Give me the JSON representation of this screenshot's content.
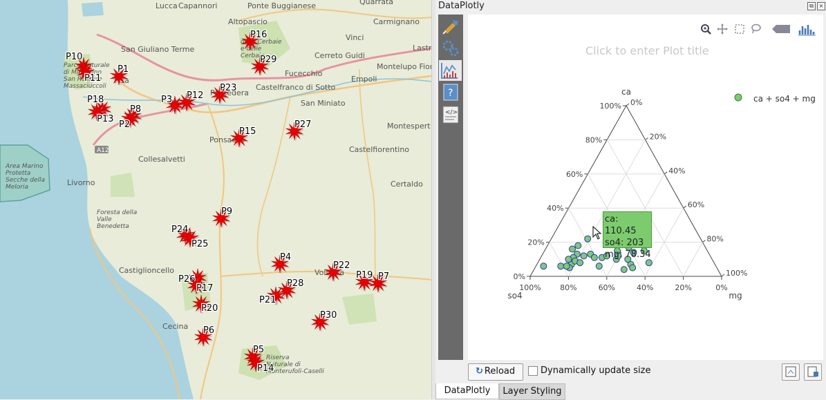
{
  "map": {
    "towns": [
      "Lucca",
      "Capannori",
      "Ponte Buggianese",
      "Quarrata",
      "Carmignano",
      "Altopascio",
      "San Giuliano Terme",
      "Cerreto Guidi",
      "Vinci",
      "Montelupo Fiorentino",
      "Lastra",
      "Pisa",
      "Fucecchio",
      "Empoli",
      "Castelfranco di Sotto",
      "Pontedera",
      "San Miniato",
      "Montespert",
      "Ponsacco",
      "Castelfiorentino",
      "Collesalvetti",
      "Livorno",
      "Certaldo",
      "Castiglioncello",
      "Volterra",
      "Cecina"
    ],
    "area_labels": [
      "Area Marino Protetta Secche della Meloria",
      "Foresta della Valle Benedetta",
      "Parco Naturale di Migliarino San Rossore Massaciuccoli",
      "Riserva Naturale di Monterufoli-Caselli",
      "delle Cerbaie e delle Cerbaie"
    ],
    "road": "A12",
    "points": [
      "P10",
      "P1",
      "P11",
      "P18",
      "P13",
      "P8",
      "P2",
      "P3",
      "P12",
      "P23",
      "P16",
      "P29",
      "P15",
      "P27",
      "P9",
      "P24",
      "P25",
      "P4",
      "P22",
      "P19",
      "P7",
      "P26",
      "P17",
      "P28",
      "P21",
      "P20",
      "P30",
      "P6",
      "P5",
      "P14"
    ]
  },
  "dock": {
    "title": "DataPlotly",
    "float_icon": "float-icon",
    "close_icon": "close-icon"
  },
  "sidebar": {
    "icons": [
      "brush-icon",
      "settings-gears-icon",
      "plot-line-icon",
      "help-icon",
      "code-icon"
    ]
  },
  "plot": {
    "title_placeholder": "Click to enter Plot title",
    "modebar": [
      "zoom-icon",
      "pan-icon",
      "box-select-icon",
      "lasso-icon",
      "plotly-logo-icon",
      "histogram-icon"
    ],
    "legend_label": "ca + so4 + mg",
    "marker_color": "#7ccc6e",
    "marker_edge": "#3030c0",
    "hover": {
      "ca": "ca: 110.45",
      "so4": "so4: 203",
      "mg": "mg: 78.34"
    },
    "hover_bg": "#7ccc6e"
  },
  "chart_data": {
    "type": "scatter",
    "subtype": "ternary",
    "axes": {
      "a": "ca",
      "b": "so4",
      "c": "mg"
    },
    "tick_labels": [
      "0%",
      "20%",
      "40%",
      "60%",
      "80%",
      "100%"
    ],
    "series": [
      {
        "name": "ca + so4 + mg",
        "points": [
          {
            "ca": 0.06,
            "so4": 0.9,
            "mg": 0.04
          },
          {
            "ca": 0.22,
            "so4": 0.59,
            "mg": 0.19
          },
          {
            "ca": 0.18,
            "so4": 0.66,
            "mg": 0.16
          },
          {
            "ca": 0.16,
            "so4": 0.7,
            "mg": 0.14
          },
          {
            "ca": 0.13,
            "so4": 0.69,
            "mg": 0.18
          },
          {
            "ca": 0.12,
            "so4": 0.66,
            "mg": 0.22
          },
          {
            "ca": 0.11,
            "so4": 0.72,
            "mg": 0.17
          },
          {
            "ca": 0.07,
            "so4": 0.75,
            "mg": 0.18
          },
          {
            "ca": 0.05,
            "so4": 0.77,
            "mg": 0.18
          },
          {
            "ca": 0.06,
            "so4": 0.81,
            "mg": 0.13
          },
          {
            "ca": 0.06,
            "so4": 0.78,
            "mg": 0.16
          },
          {
            "ca": 0.09,
            "so4": 0.72,
            "mg": 0.19
          },
          {
            "ca": 0.1,
            "so4": 0.75,
            "mg": 0.15
          },
          {
            "ca": 0.08,
            "so4": 0.7,
            "mg": 0.22
          },
          {
            "ca": 0.13,
            "so4": 0.62,
            "mg": 0.25
          },
          {
            "ca": 0.11,
            "so4": 0.61,
            "mg": 0.28
          },
          {
            "ca": 0.06,
            "so4": 0.61,
            "mg": 0.33
          },
          {
            "ca": 0.11,
            "so4": 0.57,
            "mg": 0.32
          },
          {
            "ca": 0.12,
            "so4": 0.54,
            "mg": 0.34
          },
          {
            "ca": 0.1,
            "so4": 0.5,
            "mg": 0.4
          },
          {
            "ca": 0.12,
            "so4": 0.48,
            "mg": 0.4
          },
          {
            "ca": 0.15,
            "so4": 0.47,
            "mg": 0.38
          },
          {
            "ca": 0.19,
            "so4": 0.4,
            "mg": 0.41
          },
          {
            "ca": 0.14,
            "so4": 0.39,
            "mg": 0.47
          },
          {
            "ca": 0.07,
            "so4": 0.44,
            "mg": 0.49
          },
          {
            "ca": 0.1,
            "so4": 0.44,
            "mg": 0.46
          },
          {
            "ca": 0.05,
            "so4": 0.44,
            "mg": 0.51
          },
          {
            "ca": 0.04,
            "so4": 0.49,
            "mg": 0.47
          },
          {
            "ca": 0.15,
            "so4": 0.33,
            "mg": 0.52
          },
          {
            "ca": 0.08,
            "so4": 0.34,
            "mg": 0.58
          },
          {
            "ca": 0.17,
            "so4": 0.4,
            "mg": 0.43
          }
        ]
      }
    ]
  },
  "bottom": {
    "reload_label": "Reload",
    "dynamic_label": "Dynamically update size",
    "dynamic_checked": false
  },
  "tabs": [
    {
      "label": "DataPlotly",
      "active": true
    },
    {
      "label": "Layer Styling",
      "active": false
    }
  ]
}
